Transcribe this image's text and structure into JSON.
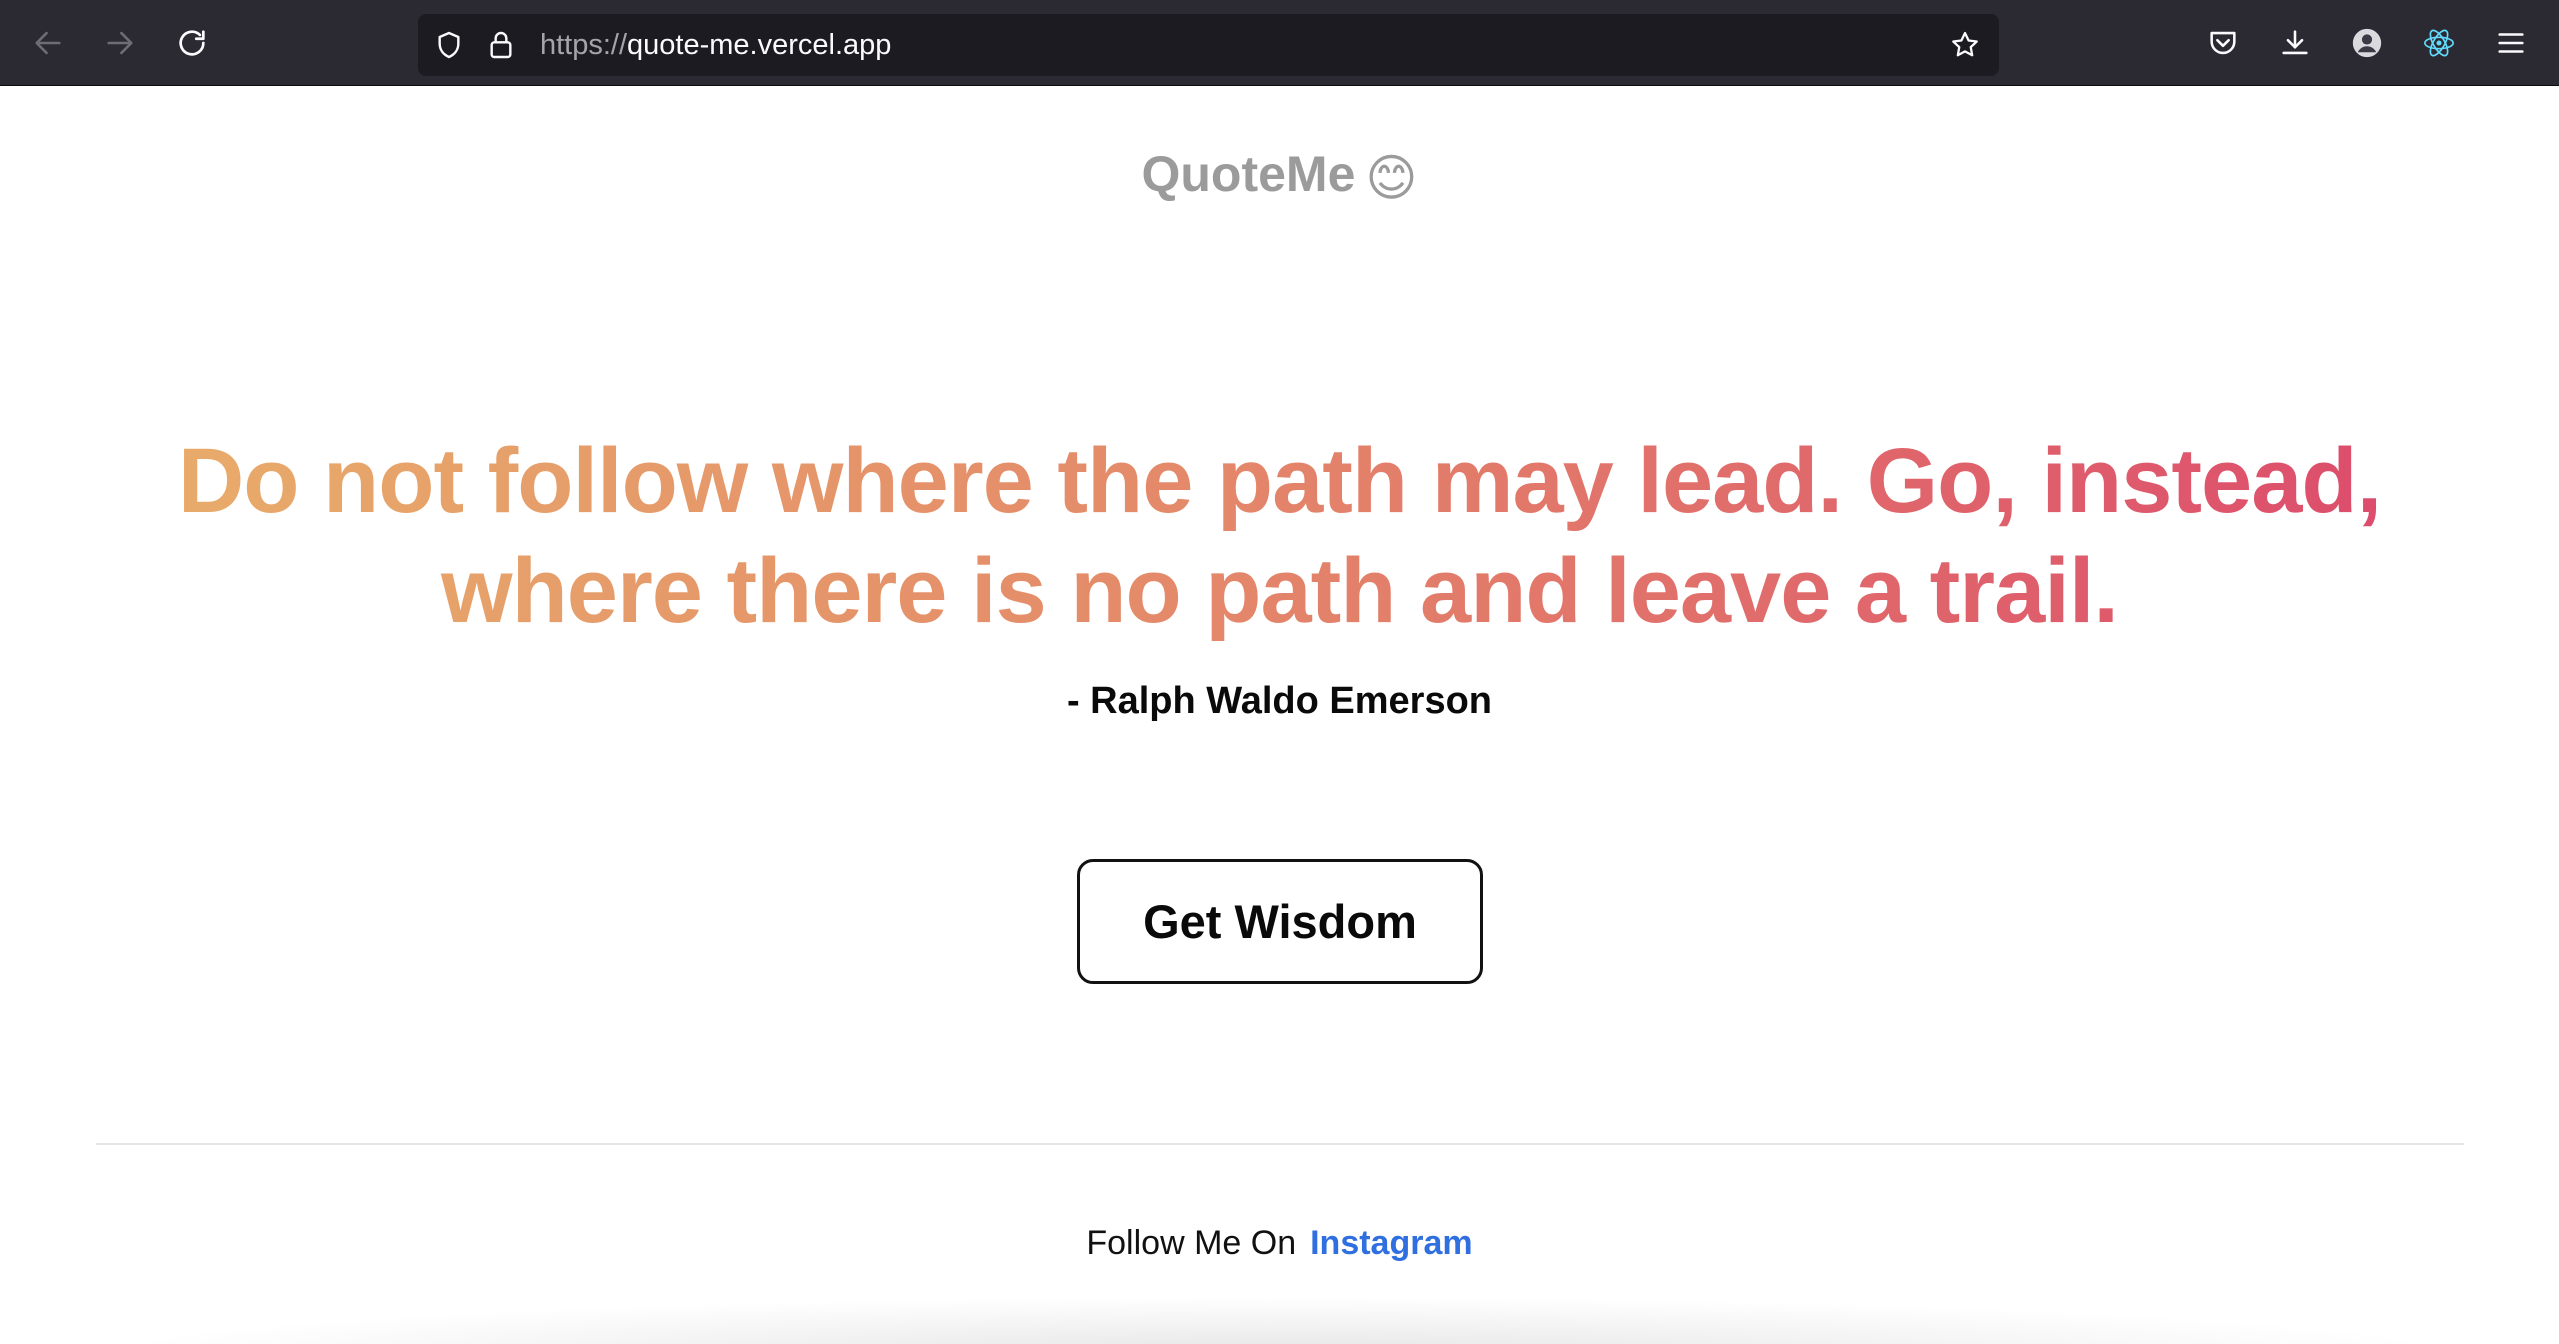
{
  "browser": {
    "url_scheme": "https://",
    "url_host": "quote-me.vercel.app",
    "icons": {
      "back": "arrow-left-icon",
      "forward": "arrow-right-icon",
      "reload": "reload-icon",
      "shield": "shield-icon",
      "lock": "lock-icon",
      "bookmark": "star-icon",
      "pocket": "pocket-icon",
      "downloads": "download-icon",
      "account": "account-icon",
      "react_devtools": "react-icon",
      "menu": "hamburger-menu-icon"
    }
  },
  "page": {
    "brand": "QuoteMe",
    "brand_emoji": "😊",
    "quote": "Do not follow where the path may lead. Go, instead, where there is no path and leave a trail.",
    "author": "- Ralph Waldo Emerson",
    "cta_label": "Get Wisdom",
    "footer_text": "Follow Me On",
    "footer_link": "Instagram"
  },
  "colors": {
    "gradient_start": "#e8ad6a",
    "gradient_end": "#dc4a6c",
    "link": "#2f6fe0",
    "brand_gray": "#9b9b9b"
  }
}
